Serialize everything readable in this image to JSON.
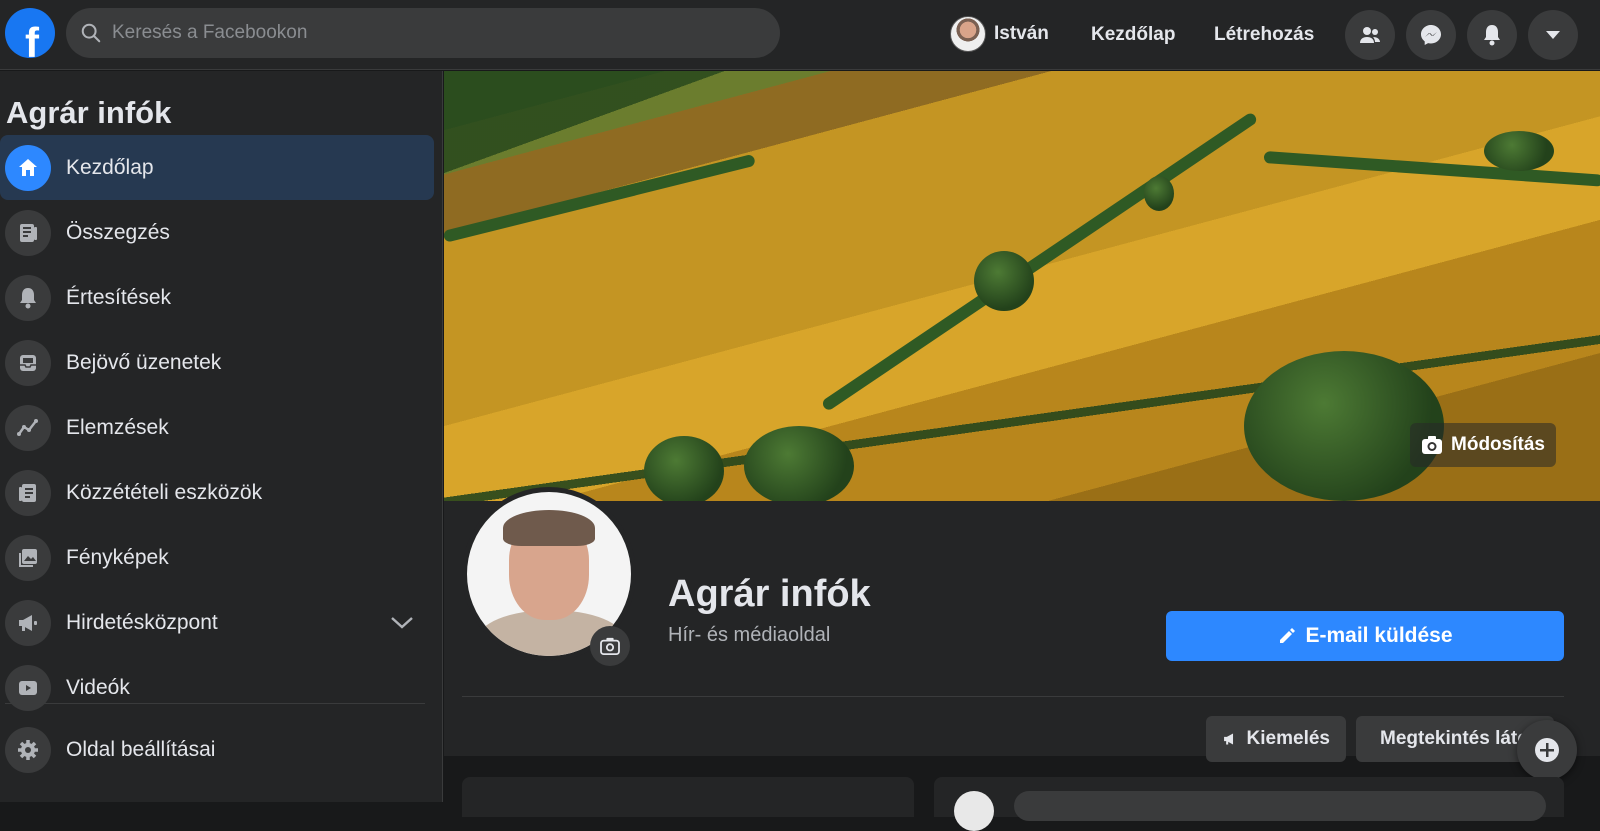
{
  "topbar": {
    "search_placeholder": "Keresés a Facebookon",
    "user_name": "István",
    "nav": [
      "Kezdőlap",
      "Létrehozás"
    ],
    "icons": [
      "friends-icon",
      "messenger-icon",
      "bell-icon",
      "caret-down-icon"
    ]
  },
  "sidebar": {
    "title": "Agrár infók",
    "items": [
      {
        "label": "Kezdőlap",
        "icon": "home-icon",
        "active": true
      },
      {
        "label": "Összegzés",
        "icon": "news-icon"
      },
      {
        "label": "Értesítések",
        "icon": "bell-icon"
      },
      {
        "label": "Bejövő üzenetek",
        "icon": "inbox-icon"
      },
      {
        "label": "Elemzések",
        "icon": "chart-icon"
      },
      {
        "label": "Közzétételi eszközök",
        "icon": "publishing-tools-icon"
      },
      {
        "label": "Fényképek",
        "icon": "photos-icon"
      },
      {
        "label": "Hirdetésközpont",
        "icon": "megaphone-icon",
        "expandable": true
      },
      {
        "label": "Videók",
        "icon": "video-icon"
      },
      {
        "label": "Oldal beállításai",
        "icon": "gear-icon"
      }
    ]
  },
  "main": {
    "cover_button": "Módosítás",
    "page_name": "Agrár infók",
    "page_category": "Hír- és médiaoldal",
    "email_button": "E-mail küldése",
    "promote_button": "Kiemelés",
    "view_as_button": "Megtekintés láto..."
  },
  "colors": {
    "background": "#18191a",
    "surface": "#242526",
    "accent": "#2d88ff",
    "brand": "#1877f2"
  }
}
